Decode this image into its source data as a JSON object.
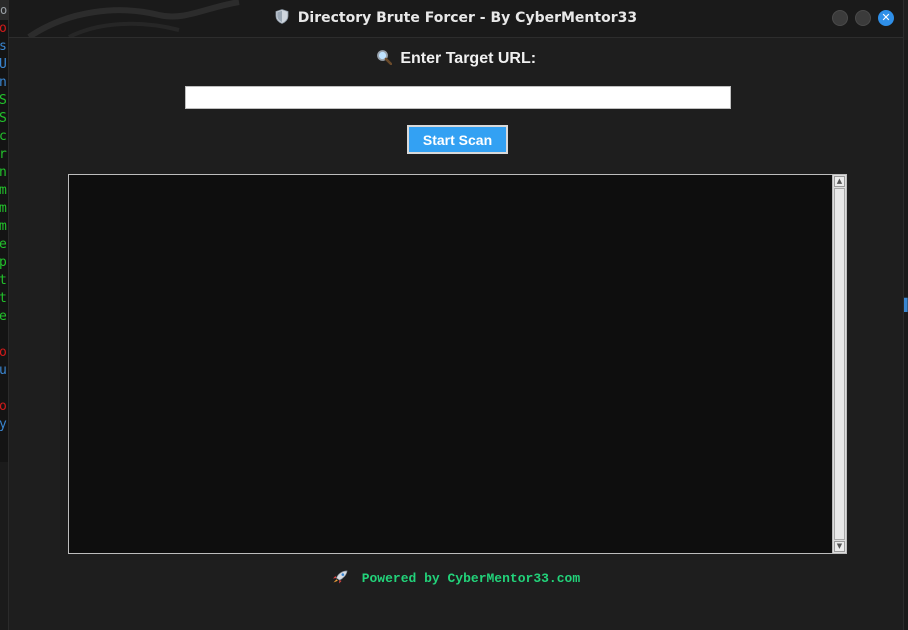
{
  "background_terminal": {
    "top_fragment": "ot",
    "lines": [
      {
        "text": "o",
        "color": "#d11a1a"
      },
      {
        "text": "s",
        "color": "#3a86d1"
      },
      {
        "text": "U",
        "color": "#3a86d1"
      },
      {
        "text": "n",
        "color": "#3a86d1"
      },
      {
        "text": "S",
        "color": "#22c12b"
      },
      {
        "text": "S",
        "color": "#22c12b"
      },
      {
        "text": "c",
        "color": "#22c12b"
      },
      {
        "text": "r",
        "color": "#22c12b"
      },
      {
        "text": "n",
        "color": "#22c12b"
      },
      {
        "text": "m",
        "color": "#22c12b"
      },
      {
        "text": "m",
        "color": "#22c12b"
      },
      {
        "text": "m",
        "color": "#22c12b"
      },
      {
        "text": "e",
        "color": "#22c12b"
      },
      {
        "text": "p",
        "color": "#22c12b"
      },
      {
        "text": "t",
        "color": "#22c12b"
      },
      {
        "text": "t",
        "color": "#22c12b"
      },
      {
        "text": "e",
        "color": "#22c12b"
      },
      {
        "text": "",
        "color": "#22c12b"
      },
      {
        "text": "o",
        "color": "#d11a1a"
      },
      {
        "text": "u",
        "color": "#3a86d1"
      },
      {
        "text": "",
        "color": "#3a86d1"
      },
      {
        "text": "o",
        "color": "#d11a1a"
      },
      {
        "text": "y",
        "color": "#3a86d1"
      }
    ]
  },
  "window": {
    "title": "Directory Brute Forcer - By CyberMentor33",
    "title_icon": "shield-icon",
    "controls": {
      "close_glyph": "✕"
    }
  },
  "form": {
    "label": "Enter Target URL:",
    "label_icon": "magnifier-icon",
    "url_value": "",
    "start_button_label": "Start Scan"
  },
  "output": {
    "text": ""
  },
  "footer": {
    "text": "Powered by CyberMentor33.com",
    "icon": "rocket-icon"
  },
  "colors": {
    "button_bg": "#33a1f3",
    "footer_text": "#22d37a",
    "close_button": "#2f8fe8",
    "window_bg": "#1e1e1e",
    "output_bg": "#0e0e0e"
  }
}
